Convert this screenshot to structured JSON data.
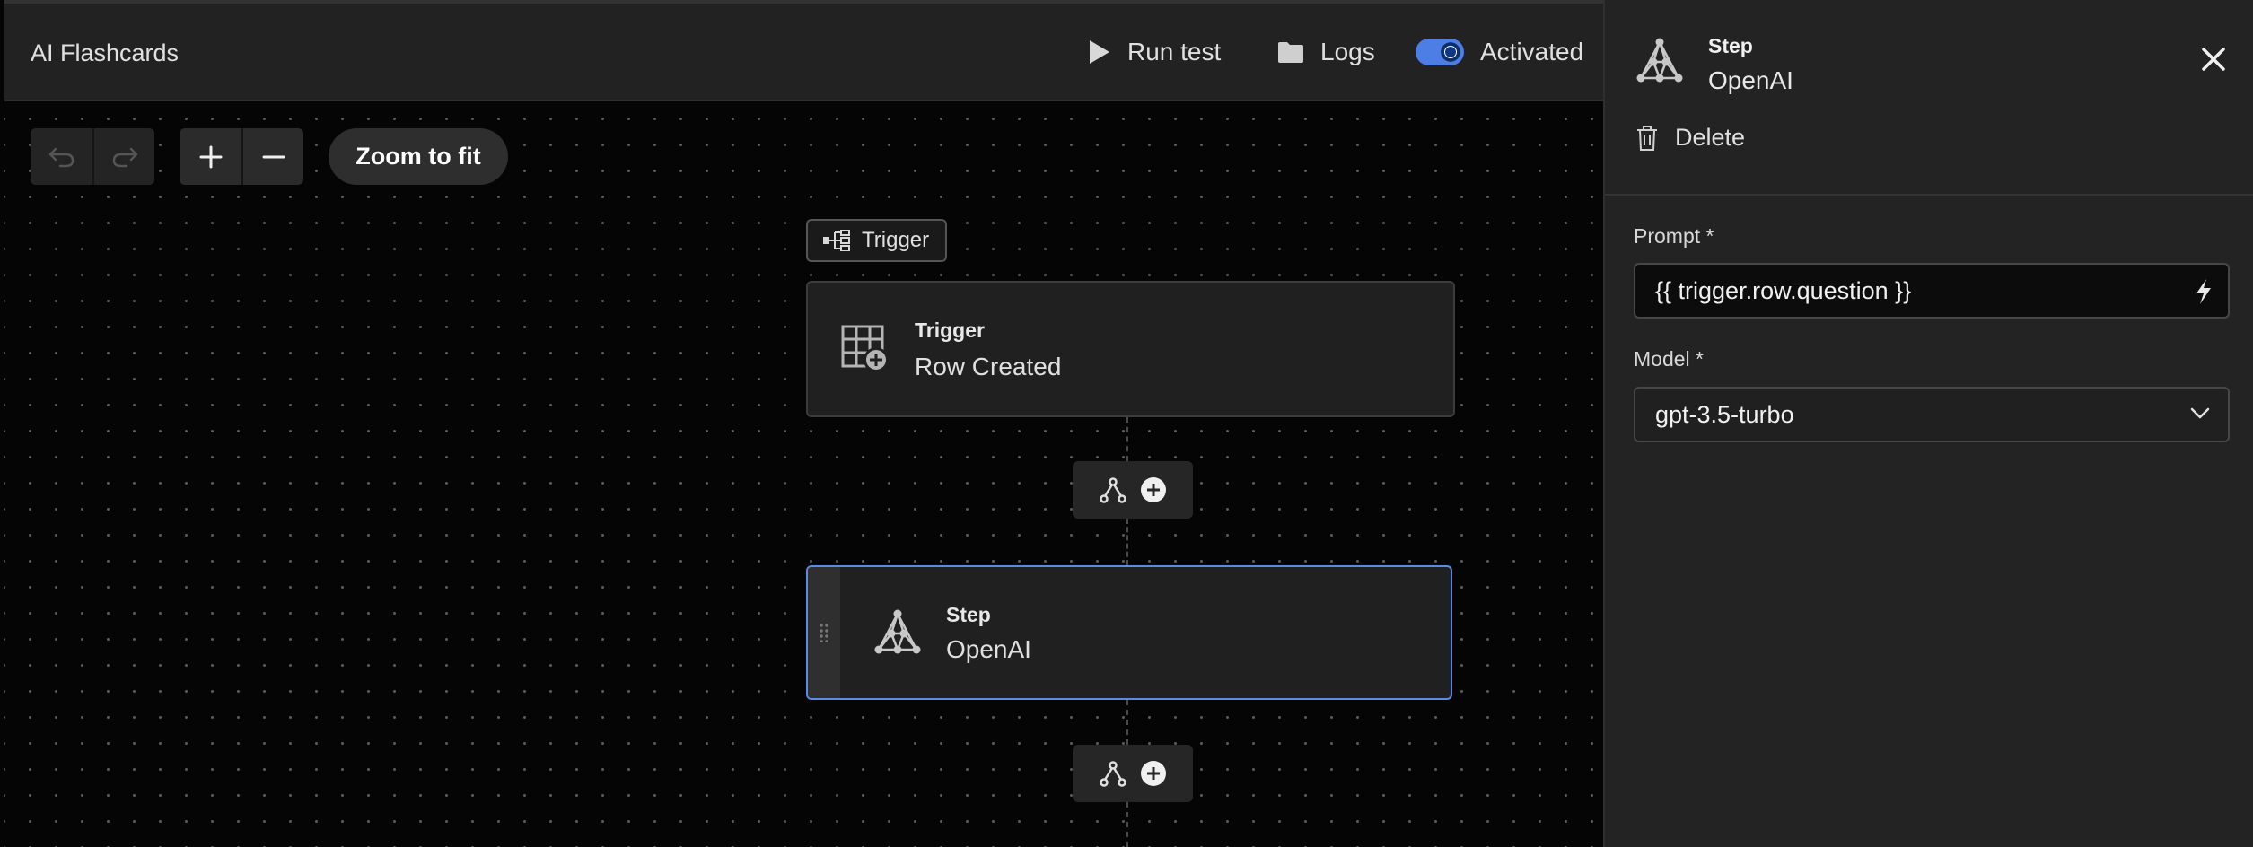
{
  "header": {
    "app_title": "AI Flashcards",
    "run_test_label": "Run test",
    "logs_label": "Logs",
    "activated_label": "Activated",
    "activated": true
  },
  "canvas_controls": {
    "zoom_to_fit_label": "Zoom to fit",
    "icons": [
      "undo-icon",
      "redo-icon",
      "zoom-in-icon",
      "zoom-out-icon"
    ]
  },
  "flow": {
    "trigger_tag_label": "Trigger",
    "trigger_node": {
      "kicker": "Trigger",
      "title": "Row Created",
      "icon": "table-add-icon"
    },
    "step_node": {
      "kicker": "Step",
      "title": "OpenAI",
      "icon": "openai-network-icon"
    }
  },
  "panel": {
    "kicker": "Step",
    "title": "OpenAI",
    "delete_label": "Delete",
    "prompt_label": "Prompt *",
    "prompt_value": "{{ trigger.row.question }}",
    "model_label": "Model *",
    "model_value": "gpt-3.5-turbo"
  },
  "colors": {
    "accent": "#4c7ee6",
    "selected_border": "#5a8be6",
    "panel_bg": "#232323",
    "canvas_bg": "#050505"
  }
}
